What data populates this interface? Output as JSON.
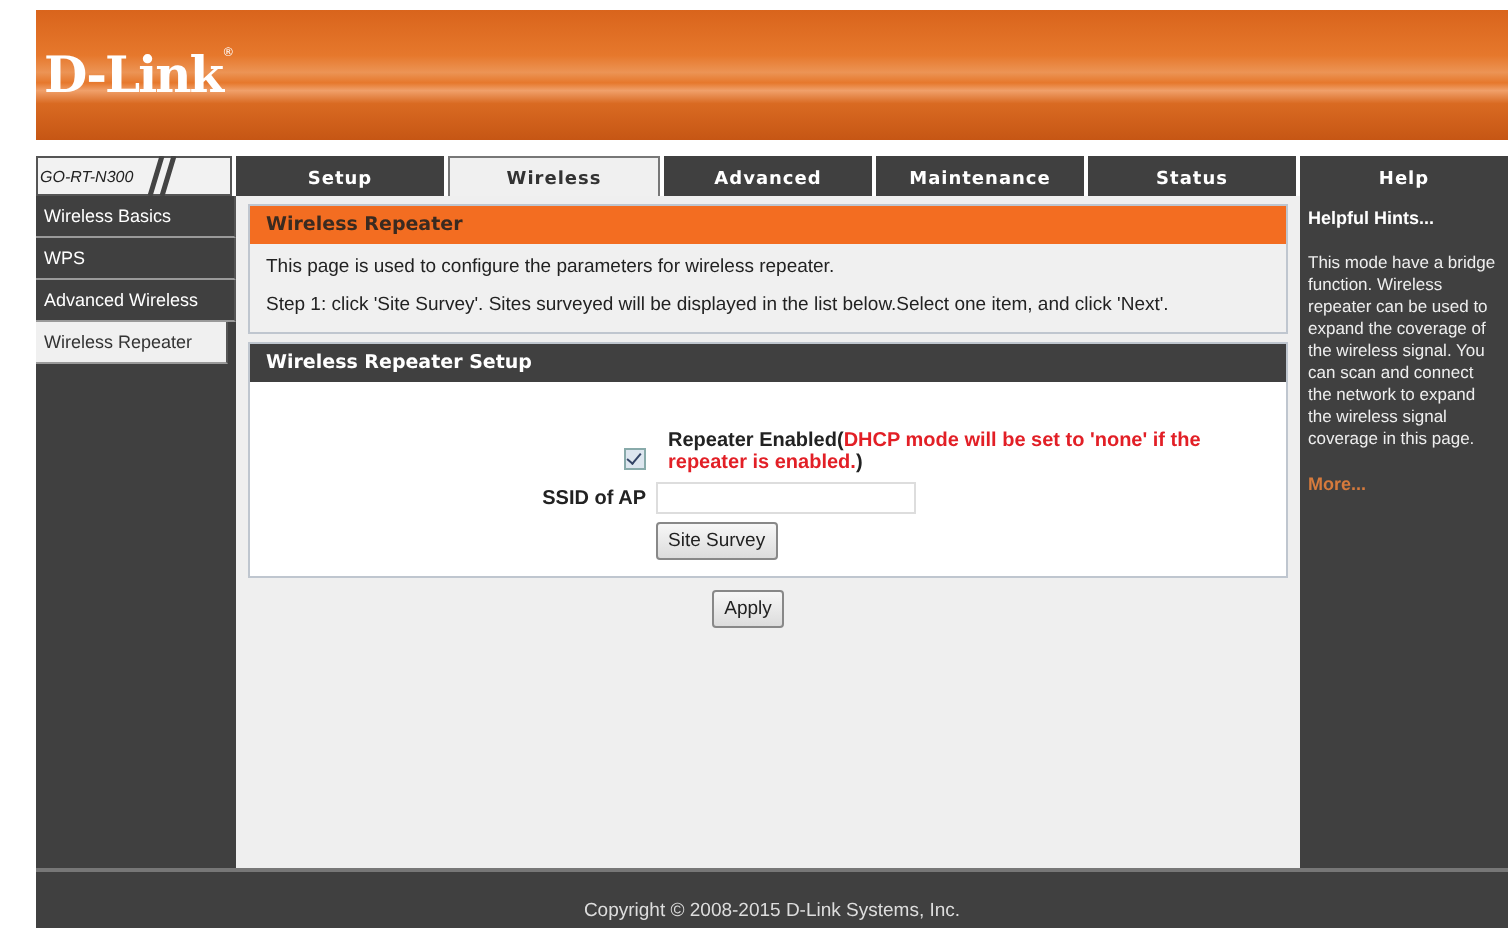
{
  "header": {
    "logo": "D-Link",
    "logo_mark": "®"
  },
  "model": "GO-RT-N300",
  "tabs": [
    {
      "label": "Setup",
      "selected": false
    },
    {
      "label": "Wireless",
      "selected": true
    },
    {
      "label": "Advanced",
      "selected": false
    },
    {
      "label": "Maintenance",
      "selected": false
    },
    {
      "label": "Status",
      "selected": false
    },
    {
      "label": "Help",
      "selected": false
    }
  ],
  "sidebar": {
    "items": [
      {
        "label": "Wireless Basics",
        "selected": false
      },
      {
        "label": "WPS",
        "selected": false
      },
      {
        "label": "Advanced Wireless",
        "selected": false
      },
      {
        "label": "Wireless Repeater",
        "selected": true
      }
    ]
  },
  "intro": {
    "title": "Wireless Repeater",
    "lines": [
      "This page is used to configure the parameters for wireless repeater.",
      "Step 1: click 'Site Survey'. Sites surveyed will be displayed in the list below.Select one item, and click 'Next'."
    ]
  },
  "setup": {
    "title": "Wireless Repeater Setup",
    "repeater": {
      "checked": true,
      "label": "Repeater Enabled(",
      "note": "DHCP mode will be set to 'none' if the repeater is enabled.",
      "label_end": ")"
    },
    "ssid_label": "SSID of AP",
    "survey_button": "Site Survey"
  },
  "apply_button": "Apply",
  "help": {
    "title": "Helpful Hints...",
    "text": "This mode have a bridge function. Wireless repeater can be used to expand the coverage of the wireless signal. You can scan and connect the network to expand the wireless signal coverage in this page.",
    "more": "More..."
  },
  "footer": "Copyright © 2008-2015 D-Link Systems, Inc."
}
